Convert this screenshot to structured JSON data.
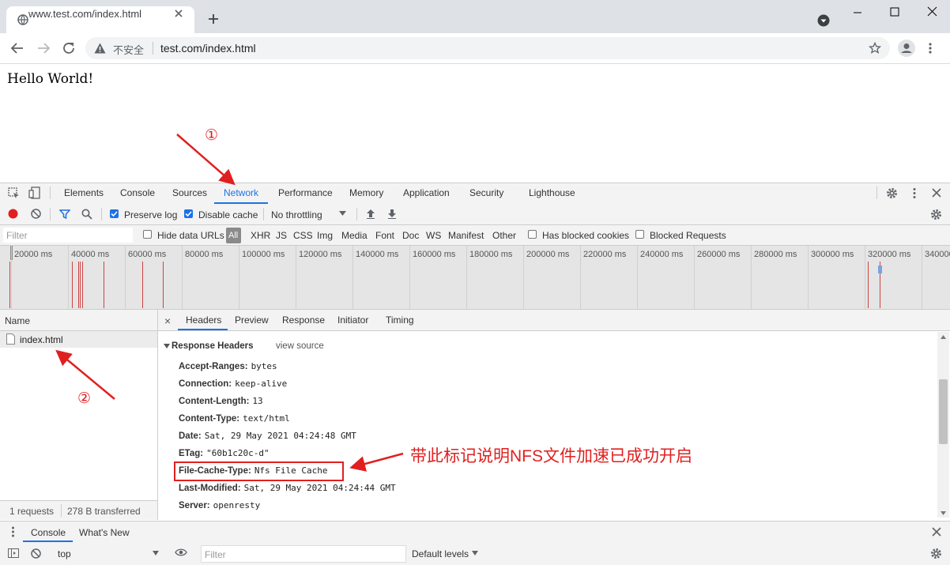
{
  "browser": {
    "tab_title": "www.test.com/index.html",
    "new_tab_label": "+",
    "not_secure_label": "不安全",
    "url": "test.com/index.html"
  },
  "page": {
    "content": "Hello World!"
  },
  "devtools": {
    "tabs": [
      "Elements",
      "Console",
      "Sources",
      "Network",
      "Performance",
      "Memory",
      "Application",
      "Security",
      "Lighthouse"
    ],
    "active_tab": "Network",
    "toolbar": {
      "preserve_log": "Preserve log",
      "disable_cache": "Disable cache",
      "throttling": "No throttling"
    },
    "filter": {
      "placeholder": "Filter",
      "hide_data_urls": "Hide data URLs",
      "types": [
        "All",
        "XHR",
        "JS",
        "CSS",
        "Img",
        "Media",
        "Font",
        "Doc",
        "WS",
        "Manifest",
        "Other"
      ],
      "has_blocked_cookies": "Has blocked cookies",
      "blocked_requests": "Blocked Requests"
    },
    "timeline_ticks": [
      "20000 ms",
      "40000 ms",
      "60000 ms",
      "80000 ms",
      "100000 ms",
      "120000 ms",
      "140000 ms",
      "160000 ms",
      "180000 ms",
      "200000 ms",
      "220000 ms",
      "240000 ms",
      "260000 ms",
      "280000 ms",
      "300000 ms",
      "320000 ms",
      "340000"
    ],
    "requests": {
      "column_name": "Name",
      "rows": [
        "index.html"
      ],
      "summary_requests": "1 requests",
      "summary_transferred": "278 B transferred"
    },
    "detail": {
      "close": "×",
      "tabs": [
        "Headers",
        "Preview",
        "Response",
        "Initiator",
        "Timing"
      ],
      "section_title": "Response Headers",
      "view_source": "view source",
      "headers": [
        {
          "key": "Accept-Ranges:",
          "value": "bytes"
        },
        {
          "key": "Connection:",
          "value": "keep-alive"
        },
        {
          "key": "Content-Length:",
          "value": "13"
        },
        {
          "key": "Content-Type:",
          "value": "text/html"
        },
        {
          "key": "Date:",
          "value": "Sat, 29 May 2021 04:24:48 GMT"
        },
        {
          "key": "ETag:",
          "value": "\"60b1c20c-d\""
        },
        {
          "key": "File-Cache-Type:",
          "value": "Nfs File Cache"
        },
        {
          "key": "Last-Modified:",
          "value": "Sat, 29 May 2021 04:24:44 GMT"
        },
        {
          "key": "Server:",
          "value": "openresty"
        }
      ]
    },
    "drawer": {
      "tabs": [
        "Console",
        "What's New"
      ],
      "context": "top",
      "filter_placeholder": "Filter",
      "levels": "Default levels"
    }
  },
  "annotations": {
    "marker_1": "①",
    "marker_2": "②",
    "note": "带此标记说明NFS文件加速已成功开启"
  },
  "colors": {
    "accent": "#1a73e8",
    "annotation": "#e02020",
    "record": "#e02020"
  }
}
